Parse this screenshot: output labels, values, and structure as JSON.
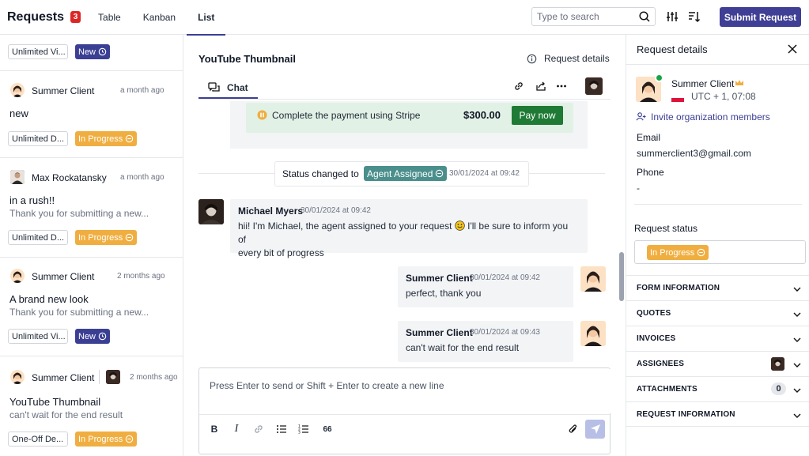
{
  "header": {
    "title": "Requests",
    "count": "3",
    "tabs": [
      "Table",
      "Kanban",
      "List"
    ],
    "search_placeholder": "Type to search",
    "submit_label": "Submit Request"
  },
  "list": {
    "items": [
      {
        "tag": "Unlimited Vi...",
        "status": "New"
      },
      {
        "name": "Summer Client",
        "time": "a month ago",
        "title": "new",
        "tag": "Unlimited D...",
        "status": "In Progress"
      },
      {
        "name": "Max Rockatansky",
        "time": "a month ago",
        "title": "in a rush!!",
        "subtitle": "Thank you for submitting a new...",
        "tag": "Unlimited D...",
        "status": "In Progress"
      },
      {
        "name": "Summer Client",
        "time": "2 months ago",
        "title": "A brand new look",
        "subtitle": "Thank you for submitting a new...",
        "tag": "Unlimited Vi...",
        "status": "New"
      },
      {
        "name": "Summer Client",
        "time": "2 months ago",
        "title": "YouTube Thumbnail",
        "subtitle": "can't wait for the end result",
        "tag": "One-Off De...",
        "status": "In Progress"
      }
    ]
  },
  "chat": {
    "title": "YouTube Thumbnail",
    "details_link": "Request details",
    "tab_label": "Chat",
    "payment": {
      "text": "Complete the payment using Stripe",
      "amount": "$300.00",
      "button": "Pay now"
    },
    "status_change": {
      "label": "Status changed to",
      "status": "Agent Assigned",
      "time": "30/01/2024 at 09:42"
    },
    "messages": [
      {
        "author": "Michael Myers",
        "time": "30/01/2024 at 09:42",
        "text_a": "hii! I'm Michael, the agent assigned to your request",
        "text_b": "I'll be sure to inform you of",
        "text_c": "every bit of progress"
      },
      {
        "author": "Summer Client",
        "time": "30/01/2024 at 09:42",
        "text": "perfect, thank you"
      },
      {
        "author": "Summer Client",
        "time": "30/01/2024 at 09:43",
        "text": "can't wait for the end result"
      }
    ],
    "composer_placeholder": "Press Enter to send or Shift + Enter to create a new line",
    "format": {
      "bold": "B",
      "italic": "I",
      "quote": "66"
    }
  },
  "details": {
    "title": "Request details",
    "client_name": "Summer Client",
    "timezone": "UTC + 1, 07:08",
    "invite_label": "Invite organization members",
    "email_label": "Email",
    "email": "summerclient3@gmail.com",
    "phone_label": "Phone",
    "phone": "-",
    "status_label": "Request status",
    "status": "In Progress",
    "sections": [
      "FORM INFORMATION",
      "QUOTES",
      "INVOICES",
      "ASSIGNEES",
      "ATTACHMENTS",
      "REQUEST INFORMATION"
    ],
    "attachments_count": "0"
  },
  "colors": {
    "accent": "#3f3f95",
    "progress": "#f0ae40",
    "agent": "#4b8f8c",
    "pay": "#1f7a35"
  }
}
